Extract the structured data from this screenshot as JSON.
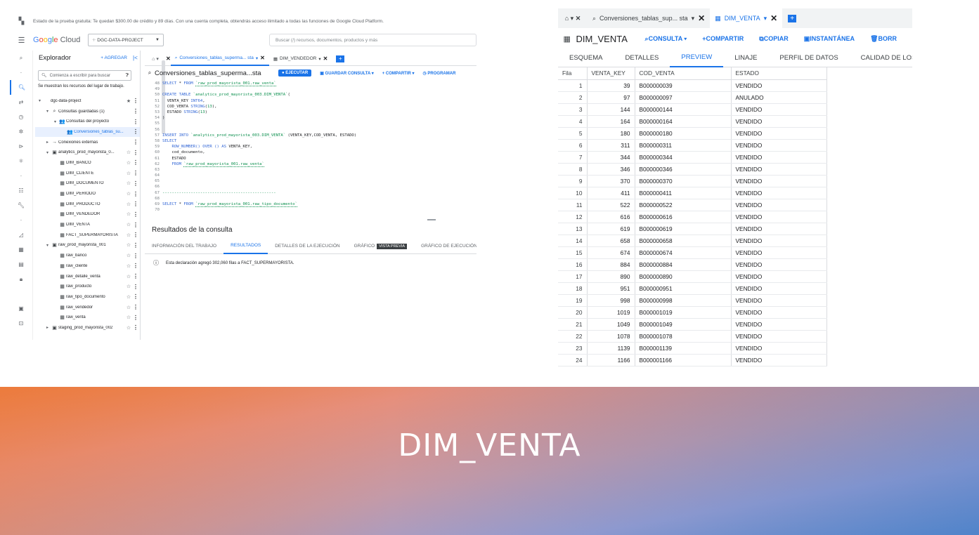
{
  "left": {
    "trial_message": "Estado de la prueba gratuita: Te quedan $300.00 de crédito y 89 días. Con una cuenta completa, obtendrás acceso ilimitado a todas las funciones de Google Cloud Platform.",
    "logo": {
      "g": "G",
      "o1": "o",
      "o2": "o",
      "g2": "g",
      "l": "l",
      "e": "e",
      "cloud": " Cloud"
    },
    "project_selector": "DGC-DATA-PROJECT",
    "search_placeholder": "Buscar (/) recursos, documentos, productos y más",
    "explorer": {
      "title": "Explorador",
      "add_label": "+ AGREGAR",
      "collapse_icon": "|<",
      "search_placeholder": "Comienza a escribir para buscar",
      "note": "Se muestran los recursos del lugar de trabajo.",
      "tree": [
        {
          "label": "dgc-data-project",
          "indent": 0,
          "exp": "▾",
          "icon": "",
          "star": "★",
          "more": "⋮"
        },
        {
          "label": "Consultas guardadas (1)",
          "indent": 1,
          "exp": "▾",
          "icon": "⌕",
          "star": "",
          "more": "⋮"
        },
        {
          "label": "Consultas del proyecto",
          "indent": 2,
          "exp": "▾",
          "icon": "👥",
          "star": "",
          "more": "⋮"
        },
        {
          "label": "Conversiones_tablas_su...",
          "indent": 3,
          "exp": "",
          "icon": "👥",
          "star": "",
          "more": "⋮",
          "selected": true
        },
        {
          "label": "Conexiones externas",
          "indent": 1,
          "exp": "▸",
          "icon": "→",
          "star": "",
          "more": "⋮"
        },
        {
          "label": "analytics_prod_mayorista_0...",
          "indent": 1,
          "exp": "▾",
          "icon": "▣",
          "star": "☆",
          "more": "⋮"
        },
        {
          "label": "DIM_BANCO",
          "indent": 2,
          "exp": "",
          "icon": "▦",
          "star": "☆",
          "more": "⋮"
        },
        {
          "label": "DIM_CLIENTE",
          "indent": 2,
          "exp": "",
          "icon": "▦",
          "star": "☆",
          "more": "⋮"
        },
        {
          "label": "DIM_DOCUMENTO",
          "indent": 2,
          "exp": "",
          "icon": "▦",
          "star": "☆",
          "more": "⋮"
        },
        {
          "label": "DIM_PERIODO",
          "indent": 2,
          "exp": "",
          "icon": "▦",
          "star": "☆",
          "more": "⋮"
        },
        {
          "label": "DIM_PRODUCTO",
          "indent": 2,
          "exp": "",
          "icon": "▦",
          "star": "☆",
          "more": "⋮"
        },
        {
          "label": "DIM_VENDEDOR",
          "indent": 2,
          "exp": "",
          "icon": "▦",
          "star": "☆",
          "more": "⋮"
        },
        {
          "label": "DIM_VENTA",
          "indent": 2,
          "exp": "",
          "icon": "▦",
          "star": "☆",
          "more": "⋮"
        },
        {
          "label": "FACT_SUPERMAYORISTA",
          "indent": 2,
          "exp": "",
          "icon": "▦",
          "star": "☆",
          "more": "⋮"
        },
        {
          "label": "raw_prod_mayorista_001",
          "indent": 1,
          "exp": "▾",
          "icon": "▣",
          "star": "☆",
          "more": "⋮"
        },
        {
          "label": "raw_banco",
          "indent": 2,
          "exp": "",
          "icon": "▦",
          "star": "☆",
          "more": "⋮"
        },
        {
          "label": "raw_cliente",
          "indent": 2,
          "exp": "",
          "icon": "▦",
          "star": "☆",
          "more": "⋮"
        },
        {
          "label": "raw_detalle_venta",
          "indent": 2,
          "exp": "",
          "icon": "▦",
          "star": "☆",
          "more": "⋮"
        },
        {
          "label": "raw_producto",
          "indent": 2,
          "exp": "",
          "icon": "▦",
          "star": "☆",
          "more": "⋮"
        },
        {
          "label": "raw_tipo_documento",
          "indent": 2,
          "exp": "",
          "icon": "▦",
          "star": "☆",
          "more": "⋮"
        },
        {
          "label": "raw_vendedor",
          "indent": 2,
          "exp": "",
          "icon": "▦",
          "star": "☆",
          "more": "⋮"
        },
        {
          "label": "raw_venta",
          "indent": 2,
          "exp": "",
          "icon": "▦",
          "star": "☆",
          "more": "⋮"
        },
        {
          "label": "staging_prod_mayorista_002",
          "indent": 1,
          "exp": "▸",
          "icon": "▣",
          "star": "☆",
          "more": "⋮"
        }
      ]
    },
    "editor_tabs": [
      {
        "label": "Conversiones_tablas_superma... sta",
        "icon": "⌕",
        "active": true
      },
      {
        "label": "DIM_VENDEDOR",
        "icon": "▦",
        "active": false
      }
    ],
    "query": {
      "name": "Conversiones_tablas_superma...sta",
      "run_label": "● EJECUTAR",
      "save_label": "▣ GUARDAR CONSULTA ▾",
      "share_label": "+ COMPARTIR ▾",
      "schedule_label": "◷ PROGRAMAR"
    },
    "code_lines": [
      {
        "n": "48",
        "parts": [
          {
            "c": "kw",
            "t": "SELECT"
          },
          {
            "c": "t",
            "t": " * "
          },
          {
            "c": "kw",
            "t": "FROM"
          },
          {
            "c": "t",
            "t": " "
          },
          {
            "c": "hl",
            "t": "`raw_prod_mayorista_001.raw_venta`"
          }
        ]
      },
      {
        "n": "49",
        "parts": []
      },
      {
        "n": "50",
        "parts": [
          {
            "c": "kw",
            "t": "CREATE TABLE"
          },
          {
            "c": "t",
            "t": " "
          },
          {
            "c": "str",
            "t": "`analytics_prod_mayorista_003.DIM_VENTA`"
          },
          {
            "c": "t",
            "t": "("
          }
        ]
      },
      {
        "n": "51",
        "parts": [
          {
            "c": "t",
            "t": "  VENTA_KEY "
          },
          {
            "c": "kw",
            "t": "INT64"
          },
          {
            "c": "t",
            "t": ","
          }
        ]
      },
      {
        "n": "52",
        "parts": [
          {
            "c": "t",
            "t": "  COD_VENTA "
          },
          {
            "c": "kw",
            "t": "STRING"
          },
          {
            "c": "t",
            "t": "("
          },
          {
            "c": "str",
            "t": "13"
          },
          {
            "c": "t",
            "t": "),"
          }
        ]
      },
      {
        "n": "53",
        "parts": [
          {
            "c": "t",
            "t": "  ESTADO "
          },
          {
            "c": "kw",
            "t": "STRING"
          },
          {
            "c": "t",
            "t": "("
          },
          {
            "c": "str",
            "t": "13"
          },
          {
            "c": "t",
            "t": ")"
          }
        ]
      },
      {
        "n": "54",
        "parts": [
          {
            "c": "t",
            "t": ")"
          }
        ]
      },
      {
        "n": "55",
        "parts": []
      },
      {
        "n": "56",
        "parts": []
      },
      {
        "n": "57",
        "parts": [
          {
            "c": "kw",
            "t": "INSERT INTO"
          },
          {
            "c": "t",
            "t": " "
          },
          {
            "c": "str",
            "t": "`analytics_prod_mayorista_003.DIM_VENTA`"
          },
          {
            "c": "t",
            "t": " (VENTA_KEY,COD_VENTA, ESTADO)"
          }
        ]
      },
      {
        "n": "58",
        "parts": [
          {
            "c": "kw",
            "t": "SELECT"
          }
        ]
      },
      {
        "n": "59",
        "parts": [
          {
            "c": "t",
            "t": "    "
          },
          {
            "c": "kw",
            "t": "ROW_NUMBER() OVER () AS"
          },
          {
            "c": "t",
            "t": " VENTA_KEY,"
          }
        ]
      },
      {
        "n": "60",
        "parts": [
          {
            "c": "t",
            "t": "    cod_documento,"
          }
        ]
      },
      {
        "n": "61",
        "parts": [
          {
            "c": "t",
            "t": "    ESTADO"
          }
        ]
      },
      {
        "n": "62",
        "parts": [
          {
            "c": "t",
            "t": "    "
          },
          {
            "c": "kw",
            "t": "FROM"
          },
          {
            "c": "t",
            "t": " "
          },
          {
            "c": "hl",
            "t": "`raw_prod_mayorista_001.raw_venta`"
          }
        ]
      },
      {
        "n": "63",
        "parts": []
      },
      {
        "n": "64",
        "parts": []
      },
      {
        "n": "65",
        "parts": []
      },
      {
        "n": "66",
        "parts": []
      },
      {
        "n": "67",
        "parts": [
          {
            "c": "sep",
            "t": "------------------------------------------------"
          }
        ]
      },
      {
        "n": "68",
        "parts": []
      },
      {
        "n": "69",
        "parts": [
          {
            "c": "kw",
            "t": "SELECT"
          },
          {
            "c": "t",
            "t": " * "
          },
          {
            "c": "kw",
            "t": "FROM"
          },
          {
            "c": "t",
            "t": " "
          },
          {
            "c": "hl",
            "t": "`raw_prod_mayorista_001.raw_tipo_documento`"
          }
        ]
      },
      {
        "n": "70",
        "parts": []
      }
    ],
    "results": {
      "title": "Resultados de la consulta",
      "tabs": [
        "INFORMACIÓN DEL TRABAJO",
        "RESULTADOS",
        "DETALLES DE LA EJECUCIÓN",
        "GRÁFICO",
        "GRÁFICO DE EJECUCIÓN"
      ],
      "preview_badge": "VISTA PREVIA",
      "message": "Esta declaración agregó 302,060 filas a FACT_SUPERMAYORISTA."
    }
  },
  "right": {
    "tabs": [
      {
        "label": "Conversiones_tablas_sup... sta",
        "icon": "⌕",
        "active": false
      },
      {
        "label": "DIM_VENTA",
        "icon": "▦",
        "active": true
      }
    ],
    "table_title": "DIM_VENTA",
    "actions": [
      "⌕CONSULTA ▾",
      "+COMPARTIR",
      "⧉COPIAR",
      "▣INSTANTÁNEA",
      "🗑BORR"
    ],
    "subtabs": [
      "ESQUEMA",
      "DETALLES",
      "PREVIEW",
      "LINAJE",
      "PERFIL DE DATOS",
      "CALIDAD DE LOS DATOS"
    ],
    "columns": [
      "Fila",
      "VENTA_KEY",
      "COD_VENTA",
      "ESTADO"
    ],
    "rows": [
      [
        1,
        39,
        "B000000039",
        "VENDIDO"
      ],
      [
        2,
        97,
        "B000000097",
        "ANULADO"
      ],
      [
        3,
        144,
        "B000000144",
        "VENDIDO"
      ],
      [
        4,
        164,
        "B000000164",
        "VENDIDO"
      ],
      [
        5,
        180,
        "B000000180",
        "VENDIDO"
      ],
      [
        6,
        311,
        "B000000311",
        "VENDIDO"
      ],
      [
        7,
        344,
        "B000000344",
        "VENDIDO"
      ],
      [
        8,
        346,
        "B000000346",
        "VENDIDO"
      ],
      [
        9,
        370,
        "B000000370",
        "VENDIDO"
      ],
      [
        10,
        411,
        "B000000411",
        "VENDIDO"
      ],
      [
        11,
        522,
        "B000000522",
        "VENDIDO"
      ],
      [
        12,
        616,
        "B000000616",
        "VENDIDO"
      ],
      [
        13,
        619,
        "B000000619",
        "VENDIDO"
      ],
      [
        14,
        658,
        "B000000658",
        "VENDIDO"
      ],
      [
        15,
        674,
        "B000000674",
        "VENDIDO"
      ],
      [
        16,
        884,
        "B000000884",
        "VENDIDO"
      ],
      [
        17,
        890,
        "B000000890",
        "VENDIDO"
      ],
      [
        18,
        951,
        "B000000951",
        "VENDIDO"
      ],
      [
        19,
        998,
        "B000000998",
        "VENDIDO"
      ],
      [
        20,
        1019,
        "B000001019",
        "VENDIDO"
      ],
      [
        21,
        1049,
        "B000001049",
        "VENDIDO"
      ],
      [
        22,
        1078,
        "B000001078",
        "VENDIDO"
      ],
      [
        23,
        1139,
        "B000001139",
        "VENDIDO"
      ],
      [
        24,
        1166,
        "B000001166",
        "VENDIDO"
      ]
    ]
  },
  "banner": {
    "title": "DIM_VENTA"
  }
}
